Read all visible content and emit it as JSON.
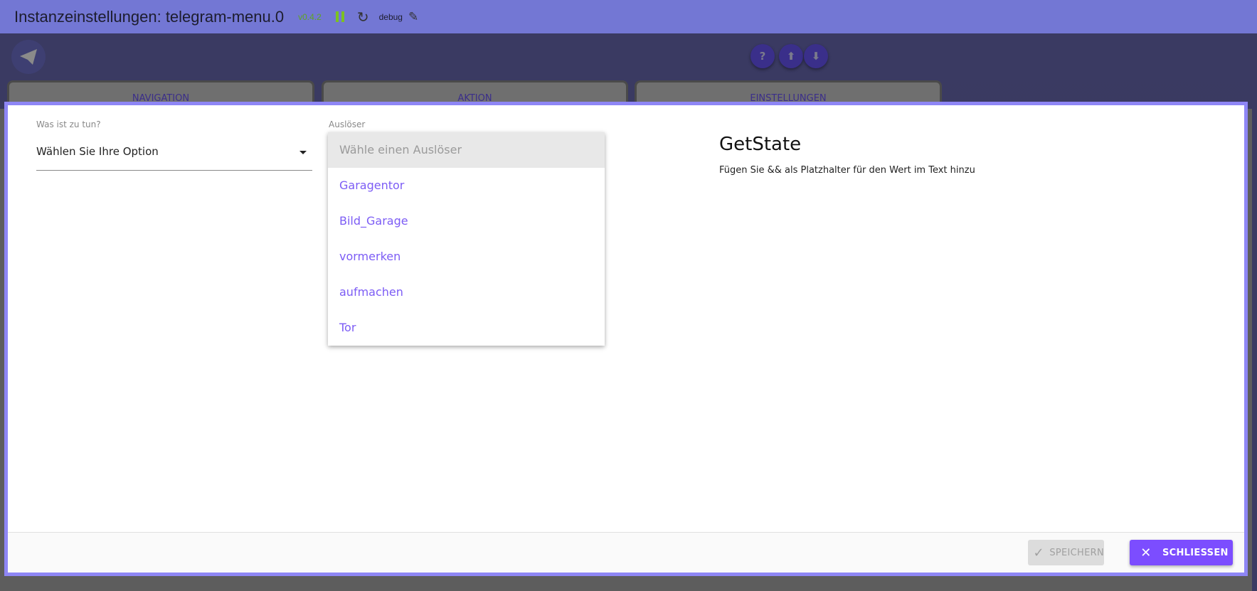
{
  "topbar": {
    "title": "Instanzeinstellungen: telegram-menu.0",
    "version": "v0.4.2",
    "log_level": "debug",
    "icons": [
      "pause-icon",
      "reload-icon",
      "edit-icon"
    ]
  },
  "header": {
    "logo": "telegram-icon",
    "buttons": [
      "help-icon",
      "upload-icon",
      "download-icon"
    ]
  },
  "tabs": [
    {
      "label": "NAVIGATION"
    },
    {
      "label": "AKTION"
    },
    {
      "label": "EINSTELLUNGEN"
    }
  ],
  "form": {
    "what_label": "Was ist zu tun?",
    "what_value": "Wählen Sie Ihre Option",
    "trigger_label": "Auslöser",
    "trigger_placeholder": "Wähle einen Auslöser",
    "trigger_options": [
      "Garagentor",
      "Bild_Garage",
      "vormerken",
      "aufmachen",
      "Tor"
    ]
  },
  "info": {
    "title": "GetState",
    "hint": "Fügen Sie && als Platzhalter für den Wert im Text hinzu"
  },
  "footer": {
    "save_label": "SPEICHERN",
    "close_label": "SCHLIESSEN"
  },
  "colors": {
    "accent": "#7c4dff",
    "topbar": "#7377d4",
    "modal_border": "#8e86f5"
  }
}
